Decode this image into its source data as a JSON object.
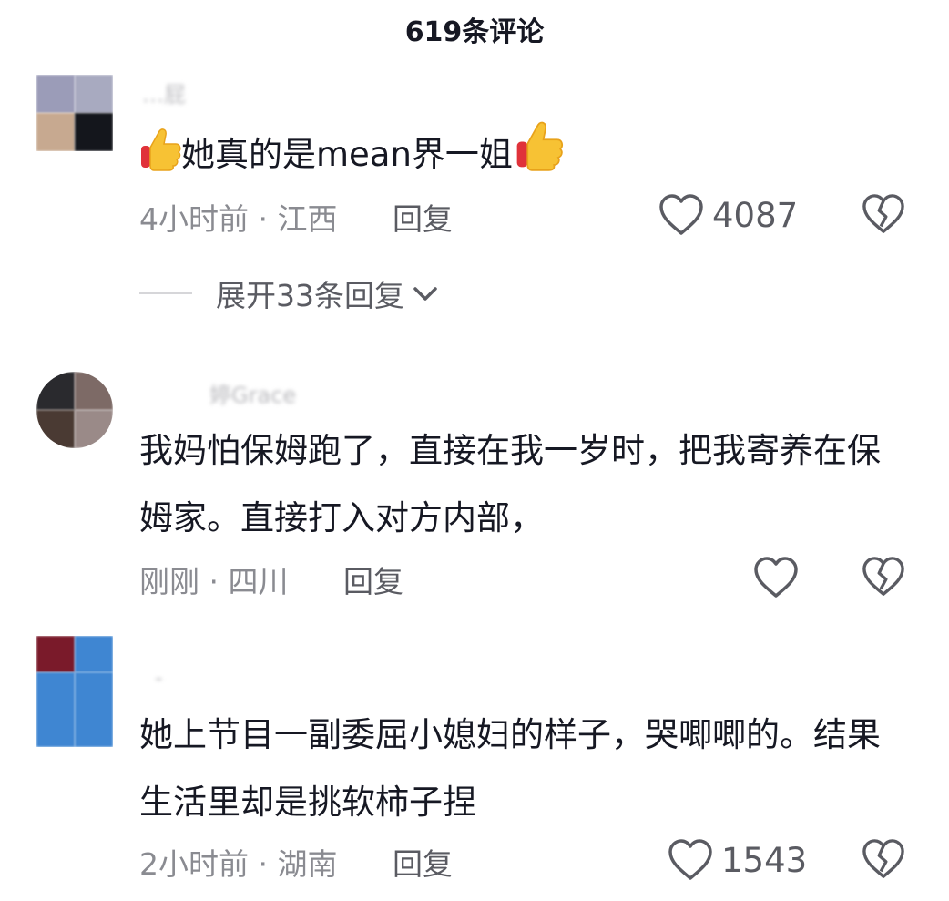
{
  "header": {
    "title": "619条评论"
  },
  "comments": [
    {
      "username": "…屁",
      "text_before": "",
      "text": "她真的是mean界一姐",
      "time": "4小时前",
      "location": "江西",
      "reply_label": "回复",
      "likes": "4087",
      "avatar_colors": [
        "#9b9cb8",
        "#a8aac0",
        "#c7a990",
        "#14161c"
      ]
    },
    {
      "username": "婷Grace",
      "text": "我妈怕保姆跑了，直接在我一岁时，把我寄养在保姆家。直接打入对方内部，",
      "time": "刚刚",
      "location": "四川",
      "reply_label": "回复",
      "likes": "",
      "avatar_colors": [
        "#2a2a2e",
        "#7d6a66",
        "#4a3a33",
        "#9a8a88"
      ]
    },
    {
      "username": "-",
      "text": "她上节目一副委屈小媳妇的样子，哭唧唧的。结果生活里却是挑软柿子捏",
      "time": "2小时前",
      "location": "湖南",
      "reply_label": "回复",
      "likes": "1543",
      "avatar_colors": [
        "#7a1a2a",
        "#3f86d2",
        "#3f86d2",
        "#3f86d2"
      ]
    }
  ],
  "expand": {
    "label": "展开33条回复"
  },
  "meta_separator": "·",
  "colors": {
    "primary_text": "#161823",
    "secondary_text": "#8a8b91",
    "icon": "#5a5b62"
  },
  "icons": [
    "heart-icon",
    "broken-heart-icon",
    "chevron-down-icon",
    "thumbs-up-emoji"
  ]
}
